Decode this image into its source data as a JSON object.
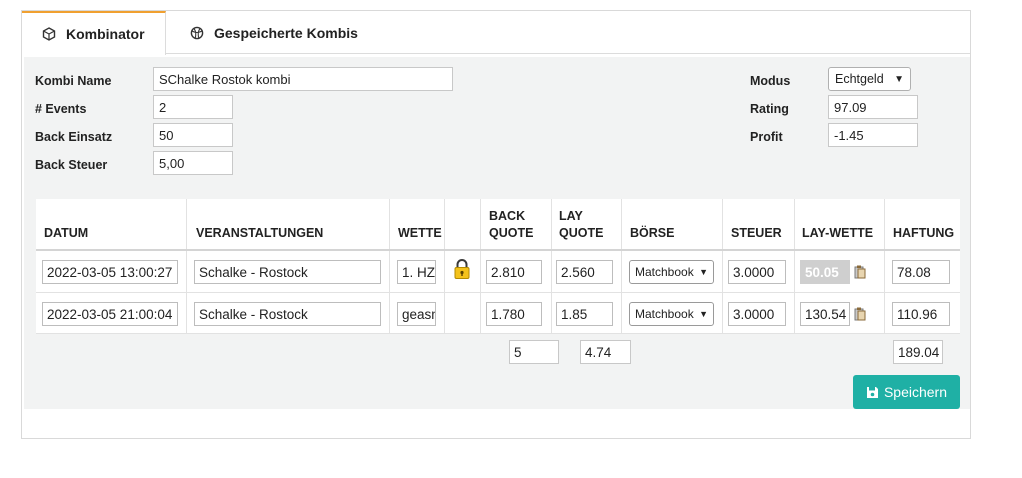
{
  "tabs": [
    {
      "label": "Kombinator",
      "icon": "cube-icon",
      "active": true
    },
    {
      "label": "Gespeicherte Kombis",
      "icon": "basketball-icon",
      "active": false
    }
  ],
  "form": {
    "kombi_name_label": "Kombi Name",
    "kombi_name_value": "SChalke Rostok kombi",
    "events_label": "# Events",
    "events_value": "2",
    "back_einsatz_label": "Back Einsatz",
    "back_einsatz_value": "50",
    "back_steuer_label": "Back Steuer",
    "back_steuer_value": "5,00",
    "modus_label": "Modus",
    "modus_value": "Echtgeld",
    "rating_label": "Rating",
    "rating_value": "97.09",
    "profit_label": "Profit",
    "profit_value": "-1.45"
  },
  "table": {
    "headers": {
      "datum": "DATUM",
      "veranstaltungen": "VERANSTALTUNGEN",
      "wette": "WETTE",
      "back_quote_1": "BACK",
      "back_quote_2": "QUOTE",
      "lay_quote_1": "LAY",
      "lay_quote_2": "QUOTE",
      "boerse": "BÖRSE",
      "steuer": "STEUER",
      "lay_wette": "LAY-WETTE",
      "haftung": "HAFTUNG"
    },
    "rows": [
      {
        "datum": "2022-03-05 13:00:27",
        "veranstaltung": "Schalke - Rostock",
        "wette": "1. HZ",
        "locked": true,
        "back_quote": "2.810",
        "lay_quote": "2.560",
        "boerse": "Matchbook",
        "steuer": "3.0000",
        "lay_wette": "50.05",
        "haftung": "78.08"
      },
      {
        "datum": "2022-03-05 21:00:04",
        "veranstaltung": "Schalke - Rostock",
        "wette": "geasn",
        "locked": false,
        "back_quote": "1.780",
        "lay_quote": "1.85",
        "boerse": "Matchbook",
        "steuer": "3.0000",
        "lay_wette": "130.54",
        "haftung": "110.96"
      }
    ],
    "totals": {
      "back_quote": "5",
      "lay_quote": "4.74",
      "haftung": "189.04"
    }
  },
  "save_button": {
    "label": "Speichern",
    "icon": "floppy-disk-icon"
  },
  "colors": {
    "accent": "#1fb0a5",
    "tab_active": "#f0a030",
    "panel_bg": "#f2f3f3"
  }
}
